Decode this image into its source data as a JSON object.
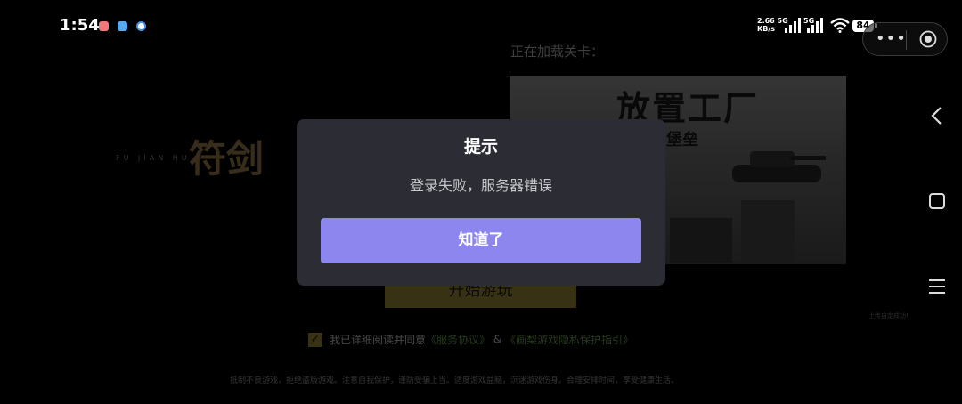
{
  "status_bar": {
    "time": "1:54",
    "net_speed_value": "2.66",
    "net_speed_unit": "KB/s",
    "signal1_label": "5G",
    "signal2_label": "5G",
    "battery": "84",
    "notification_colors": [
      "#f07a7a",
      "#5aa8f0",
      "#4a90e2"
    ]
  },
  "game": {
    "loading_label": "正在加载关卡：",
    "poster_title": "放置工厂",
    "poster_subtitle": "白堡垒",
    "logo_text": "符剑",
    "logo_pinyin": "FU JIAN HU S",
    "start_button": "开始游玩",
    "agreement_prefix": "我已详细阅读并同意",
    "agreement_link1": "《服务协议》",
    "agreement_amp": "&",
    "agreement_link2": "《画梨游戏隐私保护指引》",
    "fine_print": "抵制不良游戏，拒绝盗版游戏。注意自我保护，谨防受骗上当。适度游戏益脑，沉迷游戏伤身。合理安排时间，享受健康生活。",
    "side_note": "上传自定成功!"
  },
  "modal": {
    "title": "提示",
    "message": "登录失败，服务器错误",
    "button_label": "知道了"
  },
  "capsule": {
    "more_glyph": "•••"
  },
  "nav_icons": [
    "back-icon",
    "recent-apps-icon",
    "menu-icon"
  ]
}
